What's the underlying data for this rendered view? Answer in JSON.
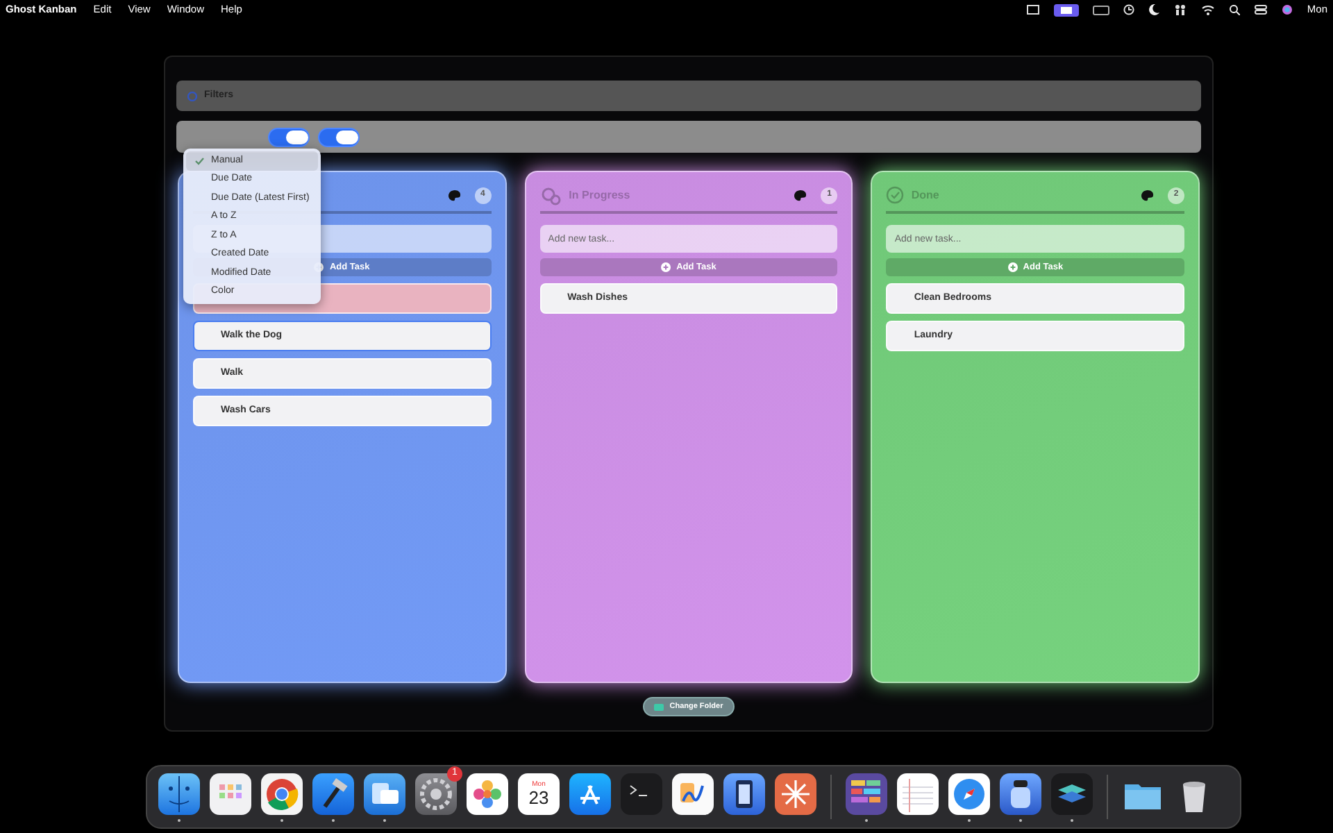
{
  "menu_bar": {
    "app_name": "Ghost Kanban",
    "menus": [
      "Edit",
      "View",
      "Window",
      "Help"
    ],
    "clock": "Mon"
  },
  "filters": {
    "title": "Filters"
  },
  "toolbar": {
    "toggles": [
      {
        "on": true
      },
      {
        "on": true
      }
    ]
  },
  "sort_menu": {
    "items": [
      {
        "label": "Manual",
        "selected": true
      },
      {
        "label": "Due Date",
        "selected": false
      },
      {
        "label": "Due Date (Latest First)",
        "selected": false
      },
      {
        "label": "A to Z",
        "selected": false
      },
      {
        "label": "Z to A",
        "selected": false
      },
      {
        "label": "Created Date",
        "selected": false
      },
      {
        "label": "Modified Date",
        "selected": false
      },
      {
        "label": "Color",
        "selected": false
      }
    ]
  },
  "columns": [
    {
      "kind": "todo",
      "count": "4",
      "add_button": "Add Task",
      "color": "#6d93ea",
      "tasks": [
        {
          "color": "#e9b3c0",
          "selected": false
        },
        {
          "title": "Walk the Dog",
          "color": "#f2f2f4",
          "selected": true
        },
        {
          "title": "Walk",
          "color": "#f2f2f4",
          "selected": false
        },
        {
          "title": "Wash Cars",
          "color": "#f2f2f4",
          "selected": false
        }
      ]
    },
    {
      "kind": "progress",
      "title": "In Progress",
      "count": "1",
      "placeholder": "Add new task...",
      "add_button": "Add Task",
      "color": "#c88ce0",
      "tasks": [
        {
          "title": "Wash Dishes",
          "color": "#f2f2f4",
          "selected": false
        }
      ]
    },
    {
      "kind": "done",
      "title": "Done",
      "count": "2",
      "placeholder": "Add new task...",
      "add_button": "Add Task",
      "color": "#70c878",
      "tasks": [
        {
          "title": "Clean Bedrooms",
          "color": "#f2f2f4",
          "selected": false
        },
        {
          "title": "Laundry",
          "color": "#f2f2f4",
          "selected": false
        }
      ]
    }
  ],
  "change_folder": "Change Folder",
  "dock": {
    "items": [
      {
        "kind": "finder",
        "running": true
      },
      {
        "kind": "launchpad",
        "running": false
      },
      {
        "kind": "chrome",
        "running": true
      },
      {
        "kind": "xcode",
        "running": true
      },
      {
        "kind": "windows",
        "running": true
      },
      {
        "kind": "settings",
        "running": false,
        "badge": "1"
      },
      {
        "kind": "photos",
        "running": false
      },
      {
        "kind": "calendar",
        "running": false,
        "day": "Mon",
        "date": "23"
      },
      {
        "kind": "appstore",
        "running": false
      },
      {
        "kind": "terminal",
        "running": false
      },
      {
        "kind": "freeform",
        "running": false
      },
      {
        "kind": "simulator",
        "running": false
      },
      {
        "kind": "starburst",
        "running": false
      },
      {
        "kind": "divider"
      },
      {
        "kind": "blocks",
        "running": true
      },
      {
        "kind": "notes",
        "running": false
      },
      {
        "kind": "safari",
        "running": true
      },
      {
        "kind": "jar",
        "running": true
      },
      {
        "kind": "layers",
        "running": true
      },
      {
        "kind": "divider"
      },
      {
        "kind": "folder",
        "running": false
      },
      {
        "kind": "trash",
        "running": false
      }
    ]
  }
}
